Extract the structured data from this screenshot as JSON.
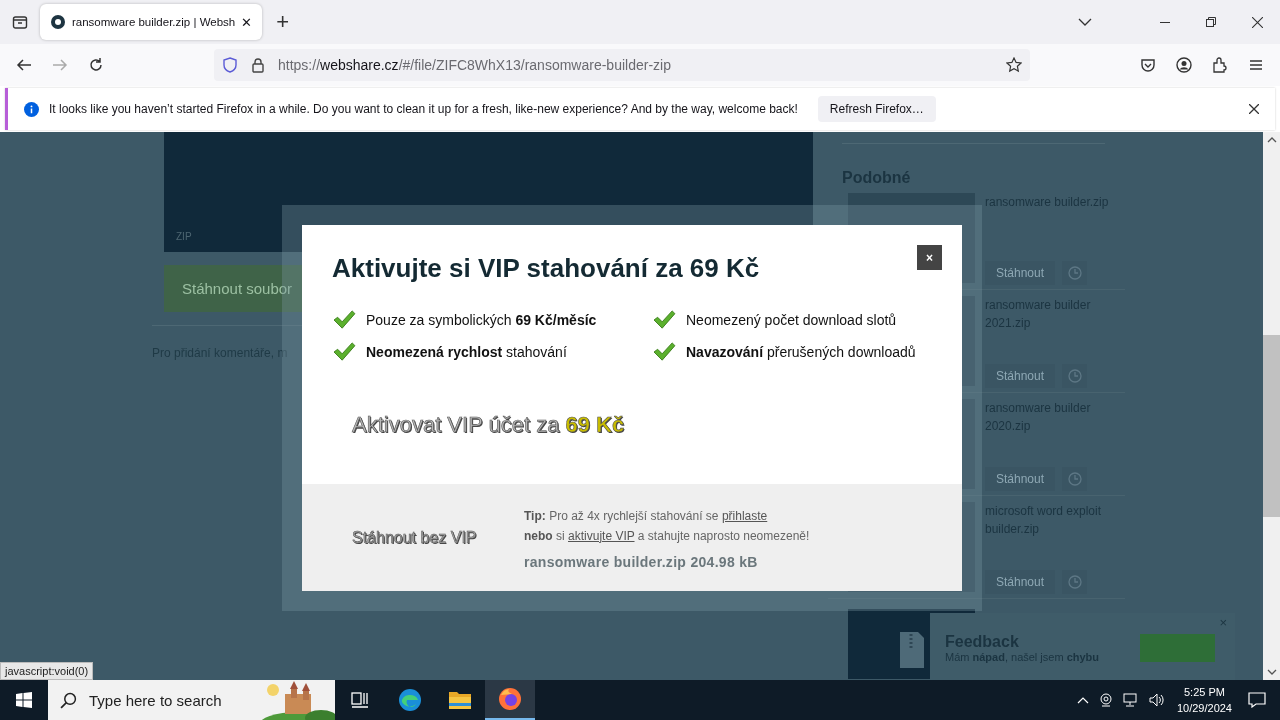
{
  "browser": {
    "tabs": [
      {
        "title": "ransomware builder.zip | Websh",
        "selected": true
      }
    ],
    "close_tab": "✕",
    "new_tab": "+",
    "url": {
      "scheme": "https://",
      "host": "webshare.cz",
      "path": "/#/file/ZIFC8WhX13/ransomware-builder-zip"
    }
  },
  "notification": {
    "message": "It looks like you haven’t started Firefox in a while. Do you want to clean it up for a fresh, like-new experience? And by the way, welcome back!",
    "button": "Refresh Firefox…"
  },
  "page": {
    "preview_label": "ZIP",
    "download_button": "Stáhnout soubor",
    "comment_note": "Pro přidání komentáře, m",
    "similar_heading": "Podobné",
    "similar": [
      {
        "name": "ransomware builder.zip",
        "button": "Stáhnout"
      },
      {
        "name": "ransomware builder 2021.zip",
        "button": "Stáhnout"
      },
      {
        "name": "ransomware builder 2020.zip",
        "button": "Stáhnout"
      },
      {
        "name": "microsoft word exploit builder.zip",
        "button": "Stáhnout"
      }
    ],
    "feedback": {
      "title": "Feedback",
      "text": "Mám **nápad**, našel jsem **chybu**",
      "close": "×"
    }
  },
  "modal": {
    "title": "Aktivujte si VIP stahování za 69 Kč",
    "close": "×",
    "features": [
      "Pouze za symbolických **69 Kč/měsíc**",
      "Neomezený počet download slotů",
      "**Neomezená rychlost** stahování",
      "**Navazování** přerušených downloadů"
    ],
    "vip_button": {
      "text": "Aktivovat VIP účet za",
      "price": "69 Kč"
    },
    "free_button": "Stáhnout bez VIP",
    "tip_lines": [
      [
        {
          "kind": "bold",
          "text": "Tip:"
        },
        {
          "kind": "text",
          "text": "Pro až 4x rychlejší stahování se"
        },
        {
          "kind": "link",
          "text": "přihlaste"
        }
      ],
      [
        {
          "kind": "bold",
          "text": "nebo"
        },
        {
          "kind": "text",
          "text": "si"
        },
        {
          "kind": "link",
          "text": "aktivujte VIP"
        },
        {
          "kind": "text",
          "text": "a stahujte naprosto neomezeně!"
        }
      ]
    ],
    "file_info": "ransomware builder.zip 204.98 kB"
  },
  "status_url": "javascript:void(0)",
  "taskbar": {
    "search_placeholder": "Type here to search",
    "apps": [
      {
        "kind": "taskview",
        "selected": false
      },
      {
        "kind": "edge",
        "selected": false
      },
      {
        "kind": "explorer",
        "selected": false
      },
      {
        "kind": "firefox",
        "selected": true
      }
    ],
    "time": "5:25 PM",
    "date": "10/29/2024"
  }
}
